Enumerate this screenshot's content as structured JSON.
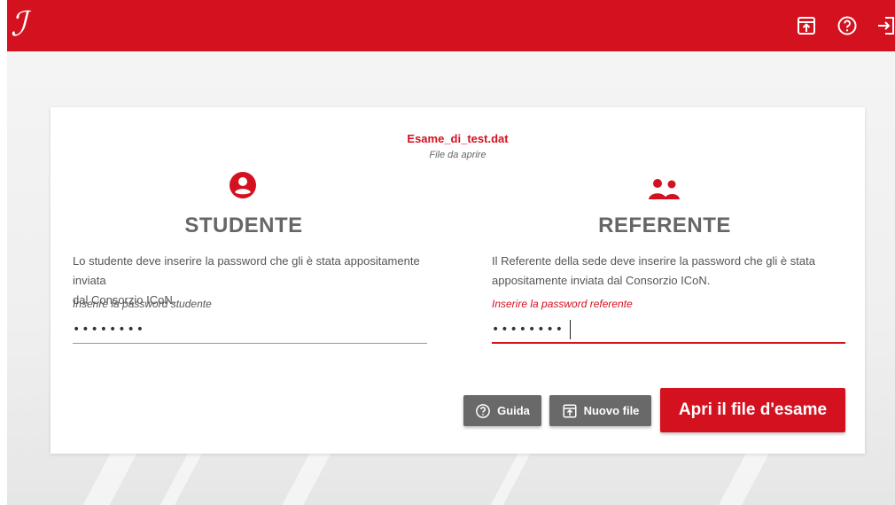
{
  "colors": {
    "brand": "#d3111f",
    "button_grey": "#696969",
    "text_grey": "#666666"
  },
  "header": {
    "logo_glyph": "ℐ",
    "icons": [
      "upload-file-icon",
      "help-icon",
      "logout-icon"
    ]
  },
  "file": {
    "name": "Esame_di_test.dat",
    "caption": "File da aprire"
  },
  "student": {
    "title": "STUDENTE",
    "description_line1": "Lo studente deve inserire la password che gli è stata appositamente inviata",
    "description_line2": "dal Consorzio ICoN.",
    "field_label": "Inserire la password studente",
    "password_value": "••••••••"
  },
  "referent": {
    "title": "REFERENTE",
    "description_line1": "Il Referente della sede deve inserire la password che gli è stata",
    "description_line2": "appositamente inviata dal Consorzio ICoN.",
    "field_label": "Inserire la password referente",
    "password_value": "••••••••"
  },
  "actions": {
    "guide_label": "Guida",
    "new_file_label": "Nuovo file",
    "open_label": "Apri il file d'esame"
  }
}
